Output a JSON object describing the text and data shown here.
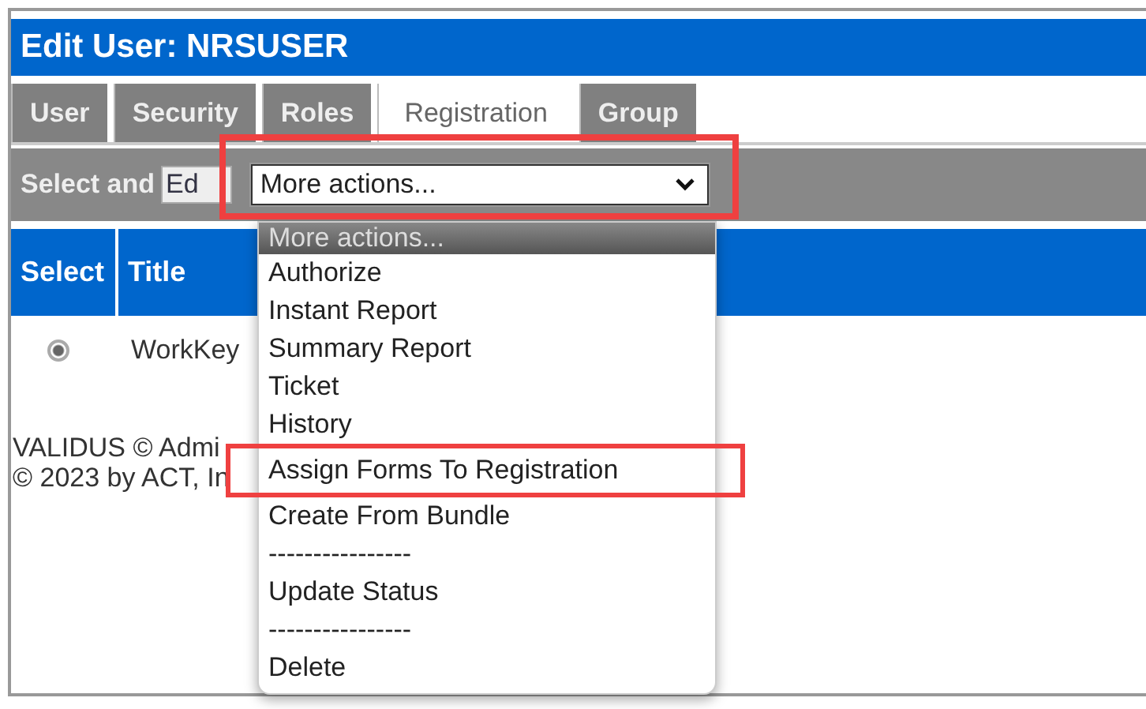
{
  "window": {
    "title": "Edit User: NRSUSER"
  },
  "tabs": [
    {
      "label": "User",
      "selected": false
    },
    {
      "label": "Security",
      "selected": false
    },
    {
      "label": "Roles",
      "selected": false
    },
    {
      "label": "Registration",
      "selected": true
    },
    {
      "label": "Group",
      "selected": false
    }
  ],
  "toolbar": {
    "label": "Select and",
    "edit_button": "Ed",
    "select": {
      "value": "More actions...",
      "expanded": true,
      "highlighted": true
    }
  },
  "table": {
    "columns": [
      "Select",
      "Title"
    ],
    "rows": [
      {
        "selected": true,
        "title": "WorkKey"
      }
    ]
  },
  "footer": [
    "VALIDUS © Admi",
    "© 2023 by ACT, In"
  ],
  "dropdown": {
    "options": [
      {
        "label": "More actions...",
        "selected": true,
        "highlighted": false
      },
      {
        "label": "Authorize",
        "selected": false,
        "highlighted": false
      },
      {
        "label": "Instant Report",
        "selected": false,
        "highlighted": false
      },
      {
        "label": "Summary Report",
        "selected": false,
        "highlighted": false
      },
      {
        "label": "Ticket",
        "selected": false,
        "highlighted": false
      },
      {
        "label": "History",
        "selected": false,
        "highlighted": false
      },
      {
        "label": "Assign Forms To Registration",
        "selected": false,
        "highlighted": true
      },
      {
        "label": "Create From Bundle",
        "selected": false,
        "highlighted": false
      },
      {
        "label": "----------------",
        "selected": false,
        "highlighted": false
      },
      {
        "label": "Update Status",
        "selected": false,
        "highlighted": false
      },
      {
        "label": "----------------",
        "selected": false,
        "highlighted": false
      },
      {
        "label": "Delete",
        "selected": false,
        "highlighted": false
      }
    ]
  }
}
